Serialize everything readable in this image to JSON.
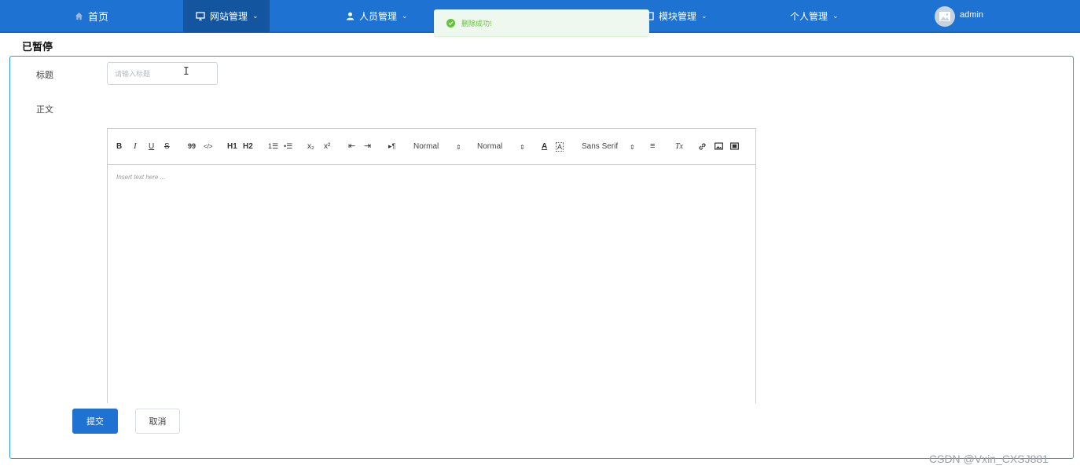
{
  "nav": {
    "items": [
      {
        "label": "首页",
        "icon": "home-icon",
        "has_dropdown": false
      },
      {
        "label": "网站管理",
        "icon": "monitor-icon",
        "has_dropdown": true,
        "active": true
      },
      {
        "label": "人员管理",
        "icon": "user-icon",
        "has_dropdown": true
      },
      {
        "label": "模块管理",
        "icon": "module-icon",
        "has_dropdown": true
      },
      {
        "label": "个人管理",
        "icon": "",
        "has_dropdown": true
      }
    ],
    "username": "admin",
    "bg_color": "#1e73d2",
    "active_color": "#13559f"
  },
  "toast": {
    "message": "删除成功!",
    "type": "success",
    "color": "#67c23a"
  },
  "page": {
    "title": "已暂停"
  },
  "form": {
    "title_label": "标题",
    "title_placeholder": "请输入标题",
    "title_value": "",
    "body_label": "正文"
  },
  "editor": {
    "toolbar": {
      "bold": "B",
      "italic": "I",
      "underline": "U",
      "strike": "S",
      "blockquote": "99",
      "code": "</>",
      "h1": "H1",
      "h2": "H2",
      "ordered_list": "1☰",
      "bullet_list": "•☰",
      "subscript": "x₂",
      "superscript": "x²",
      "outdent": "⇤",
      "indent": "⇥",
      "direction": "▸¶",
      "size_select": "Normal",
      "header_select": "Normal",
      "color": "A",
      "background": "A",
      "font_select": "Sans Serif",
      "align": "≡",
      "clean": "Tx",
      "link": "link",
      "image": "image",
      "video": "video"
    },
    "placeholder": "Insert text here ..."
  },
  "buttons": {
    "submit": "提交",
    "cancel": "取消"
  },
  "watermark": "CSDN @Vxin_CXSJ881"
}
